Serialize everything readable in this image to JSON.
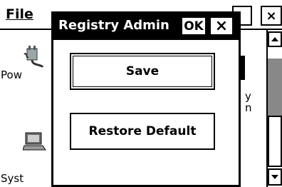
{
  "background_window": {
    "menu": {
      "file_label": "File"
    },
    "buttons": {
      "ok_partial": "",
      "close_symbol": "×"
    },
    "items": [
      {
        "label": "Pow",
        "icon": "power-plug-icon"
      },
      {
        "label": "Syst",
        "icon": "system-computer-icon"
      }
    ],
    "right_fragments": [
      "y",
      "n"
    ]
  },
  "dialog": {
    "title": "Registry Admin",
    "ok_label": "OK",
    "close_symbol": "×",
    "save_label": "Save",
    "restore_label": "Restore Default"
  }
}
